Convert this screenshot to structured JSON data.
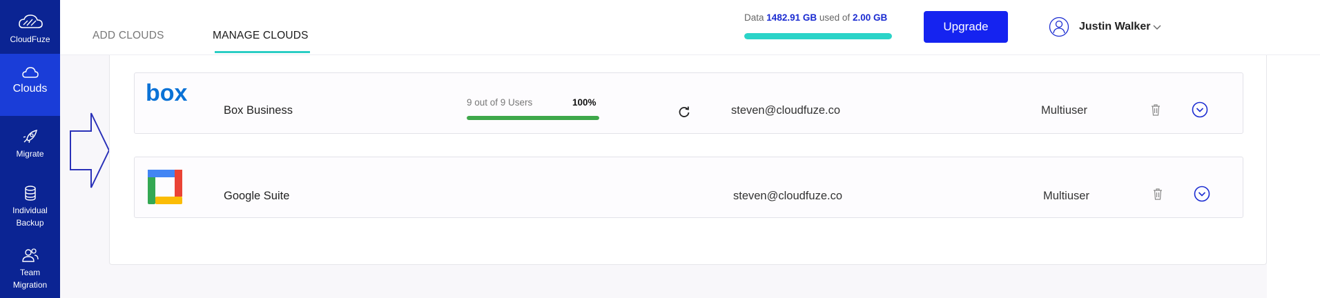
{
  "brand": {
    "name": "CloudFuze"
  },
  "sidebar": {
    "items": [
      {
        "label": "Clouds",
        "icon": "cloud-icon",
        "active": true
      },
      {
        "label": "Migrate",
        "icon": "rocket-icon"
      },
      {
        "label": "Individual Backup",
        "icon": "database-icon"
      },
      {
        "label": "Team Migration",
        "icon": "team-icon"
      }
    ]
  },
  "tabs": [
    {
      "label": "ADD CLOUDS"
    },
    {
      "label": "MANAGE CLOUDS",
      "active": true
    }
  ],
  "usage": {
    "prefix": "Data",
    "used": "1482.91 GB",
    "middle": "used of",
    "total": "2.00 GB",
    "fill_fraction": 1.0
  },
  "upgrade_label": "Upgrade",
  "user": {
    "name": "Justin Walker"
  },
  "clouds": [
    {
      "name": "Box Business",
      "logo": "box-logo",
      "users_text": "9 out of 9 Users",
      "percent": "100%",
      "progress_fraction": 1.0,
      "email": "steven@cloudfuze.co",
      "type": "Multiuser"
    },
    {
      "name": "Google Suite",
      "logo": "google-suite-logo",
      "email": "steven@cloudfuze.co",
      "type": "Multiuser"
    }
  ],
  "colors": {
    "sidebar": "#0b2493",
    "sidebar_active": "#1a3dd8",
    "accent": "#2bcdc4",
    "upgrade": "#1523f0",
    "progress": "#3ea84a"
  }
}
